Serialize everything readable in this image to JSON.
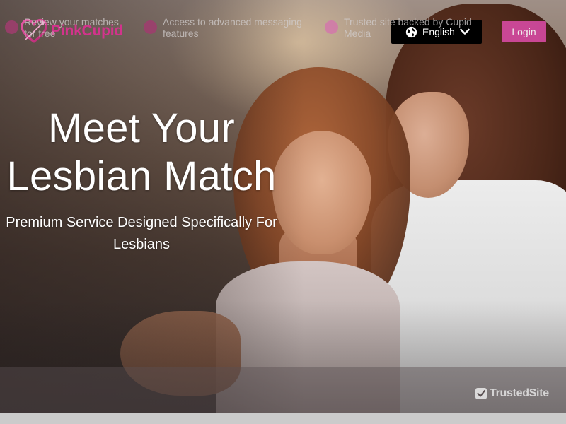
{
  "header": {
    "logo_text": "PinkCupid",
    "language": {
      "selected": "English",
      "icon": "globe-icon",
      "chevron_icon": "chevron-down-icon"
    },
    "login_label": "Login"
  },
  "hero": {
    "headline_line1": "Meet Your",
    "headline_line2": "Lesbian Match",
    "subheadline": "Premium Service Designed Specifically For Lesbians"
  },
  "features": [
    {
      "text": "Review your matches for free"
    },
    {
      "text": "Access to advanced messaging features"
    },
    {
      "text": "Trusted site backed by Cupid Media"
    }
  ],
  "trusted_badge": {
    "label": "TrustedSite",
    "icon": "checkmark-icon"
  },
  "colors": {
    "brand_pink": "#d2338c",
    "login_button": "#d44aa0",
    "language_bg": "#000000"
  }
}
